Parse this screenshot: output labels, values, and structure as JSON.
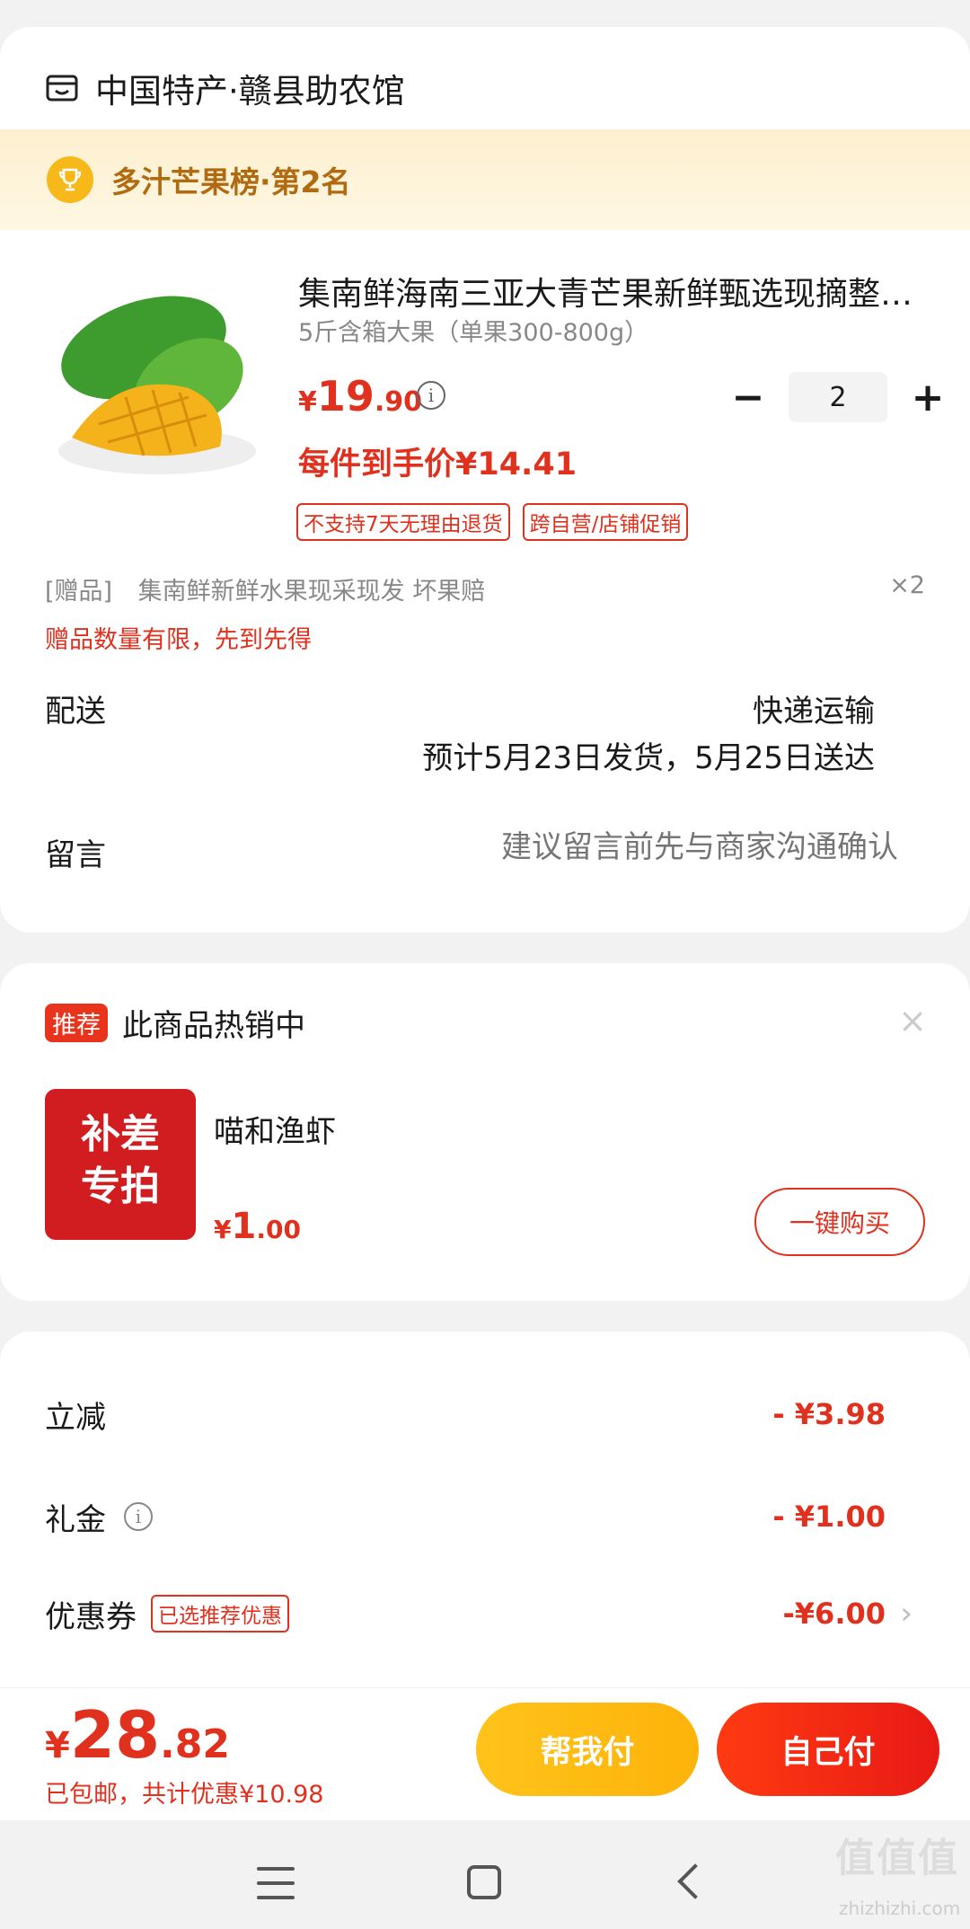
{
  "store": {
    "name": "中国特产·赣县助农馆",
    "icon": "store-icon"
  },
  "rank": {
    "text": "多汁芒果榜·第2名",
    "icon": "trophy-icon"
  },
  "product": {
    "title": "集南鲜海南三亚大青芒果新鲜甄选现摘整箱包邮",
    "spec": "5斤含箱大果（单果300-800g）",
    "price_symbol": "¥",
    "price_int": "19",
    "price_dec": ".90",
    "quantity": "2",
    "final_price": "每件到手价¥14.41",
    "tags": [
      "不支持7天无理由退货",
      "跨自营/店铺促销"
    ]
  },
  "gift": {
    "label": "[赠品]",
    "text": "集南鲜新鲜水果现采现发 坏果赔",
    "qty": "×2",
    "note": "赠品数量有限，先到先得"
  },
  "delivery": {
    "label": "配送",
    "method": "快递运输",
    "eta": "预计5月23日发货，5月25日送达"
  },
  "note": {
    "label": "留言",
    "placeholder": "建议留言前先与商家沟通确认"
  },
  "recommend": {
    "badge": "推荐",
    "title": "此商品热销中",
    "close": "×",
    "image_line1": "补差",
    "image_line2": "专拍",
    "name": "喵和渔虾",
    "price_symbol": "¥",
    "price_int": "1",
    "price_dec": ".00",
    "buy_label": "一键购买"
  },
  "summary": {
    "discount_label": "立减",
    "discount_value": "- ¥3.98",
    "gift_label": "礼金",
    "gift_value": "- ¥1.00",
    "coupon_label": "优惠券",
    "coupon_tag": "已选推荐优惠",
    "coupon_value": "-¥6.00"
  },
  "bottom": {
    "price_symbol": "¥",
    "price_int": "28",
    "price_dec": ".82",
    "note": "已包邮，共计优惠¥10.98",
    "help_pay": "帮我付",
    "self_pay": "自己付"
  },
  "watermark": {
    "logo": "值值值",
    "site": "zhizhizhi.com"
  },
  "colors": {
    "accent": "#e0301e",
    "gold": "#fdb30a",
    "rank_text": "#b06a10"
  }
}
